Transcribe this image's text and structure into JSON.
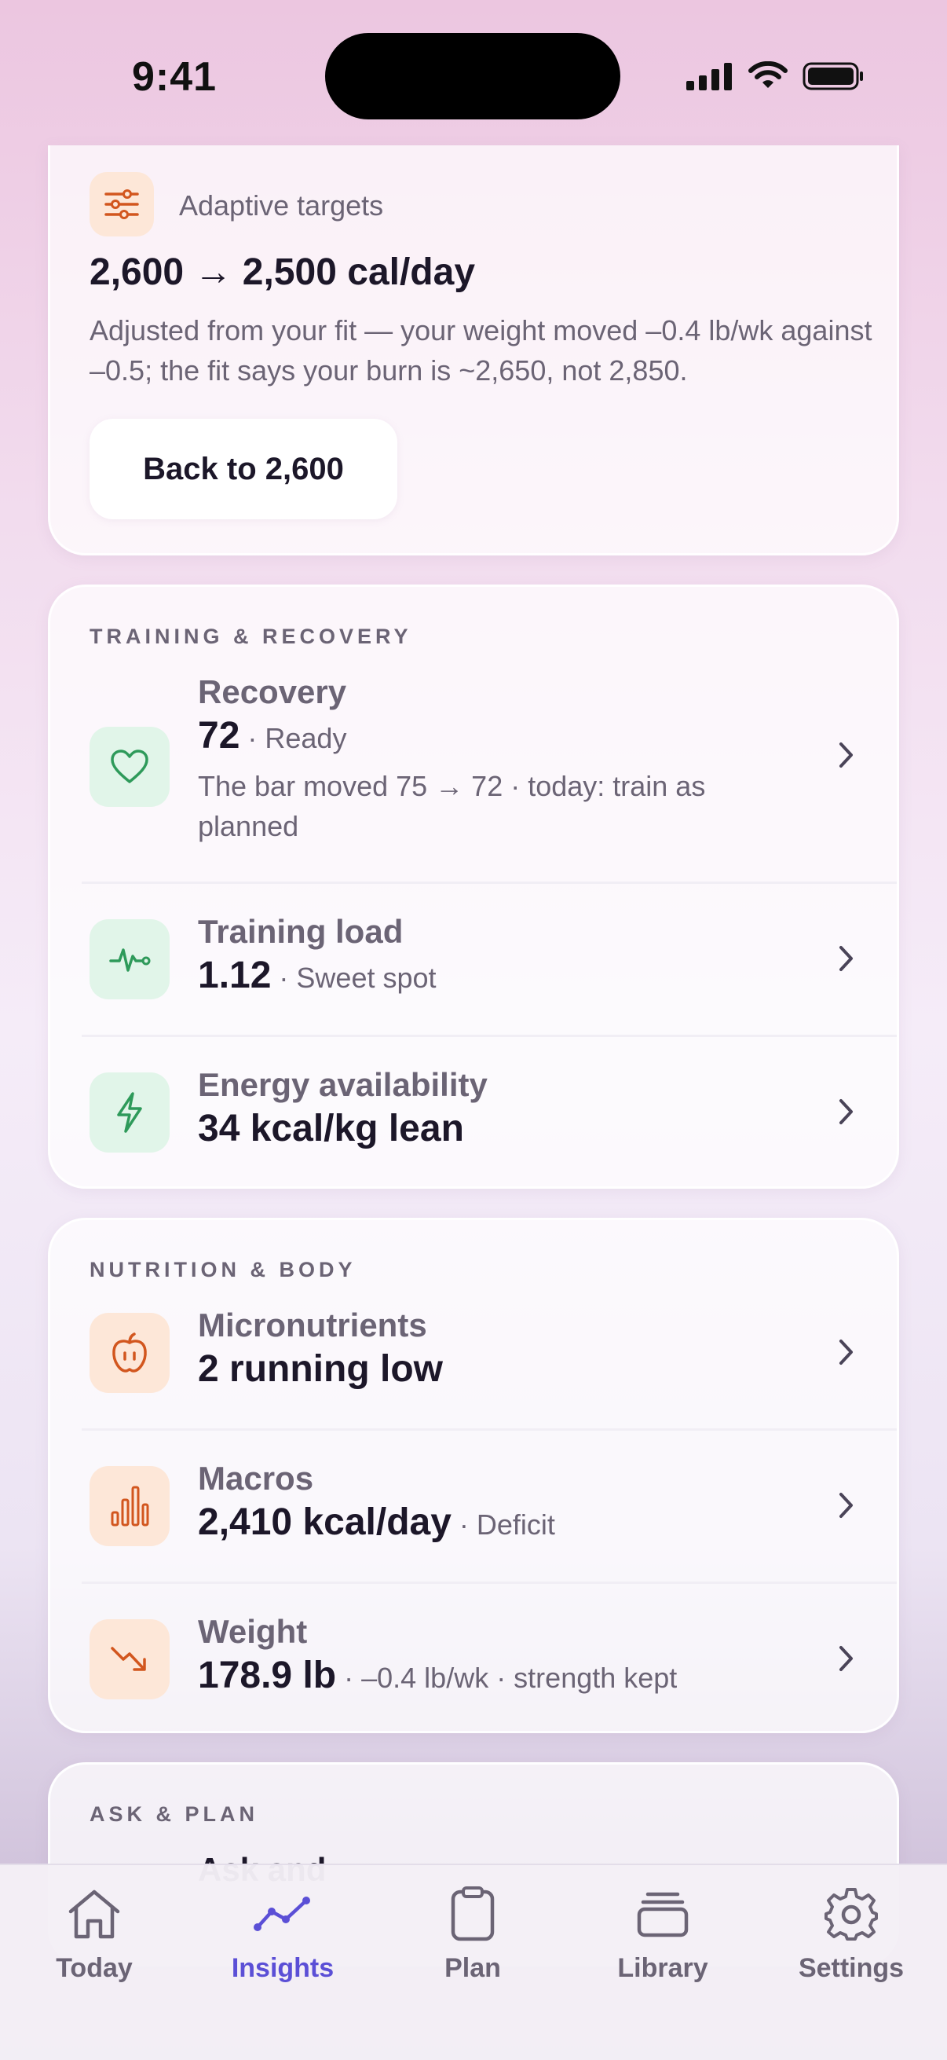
{
  "status_bar": {
    "time": "9:41"
  },
  "adaptive_card": {
    "icon": "sliders-icon",
    "label": "Adaptive targets",
    "value": "2,600 → 2,500 cal/day",
    "description": "Adjusted from your fit — your weight moved –0.4 lb/wk against –0.5; the fit says your burn is ~2,650, not 2,850.",
    "button_label": "Back to 2,600"
  },
  "training_card": {
    "section_title": "TRAINING & RECOVERY",
    "recovery": {
      "icon": "heart-icon",
      "title": "Recovery",
      "value": "72",
      "sub": " · Ready",
      "description": "The bar moved 75 → 72 · today: train as planned"
    },
    "training_load": {
      "icon": "pulse-icon",
      "title": "Training load",
      "value": "1.12",
      "sub": " · Sweet spot"
    },
    "energy": {
      "icon": "bolt-icon",
      "title": "Energy availability",
      "value": "34 kcal/kg lean"
    }
  },
  "nutrition_card": {
    "section_title": "NUTRITION & BODY",
    "micronutrients": {
      "icon": "apple-icon",
      "title": "Micronutrients",
      "value": "2 running low"
    },
    "macros": {
      "icon": "bar-chart-icon",
      "title": "Macros",
      "value": "2,410 kcal/day",
      "sub": " · Deficit"
    },
    "weight": {
      "icon": "trend-down-icon",
      "title": "Weight",
      "value": "178.9 lb",
      "sub": " · –0.4 lb/wk · strength kept"
    }
  },
  "ask_card": {
    "section_title": "ASK & PLAN",
    "partial_text": "Ask and"
  },
  "tabbar": {
    "active": "Insights",
    "tabs": [
      {
        "label": "Today",
        "icon": "house-icon"
      },
      {
        "label": "Insights",
        "icon": "trend-icon"
      },
      {
        "label": "Plan",
        "icon": "clipboard-icon"
      },
      {
        "label": "Library",
        "icon": "stack-icon"
      },
      {
        "label": "Settings",
        "icon": "gear-icon"
      }
    ]
  },
  "colors": {
    "accent": "#5b4fd6",
    "green": "#2e9a5a",
    "orange": "#d2561e",
    "icon_green_bg": "#e1f5e9",
    "icon_orange_bg": "#fde7d8"
  }
}
